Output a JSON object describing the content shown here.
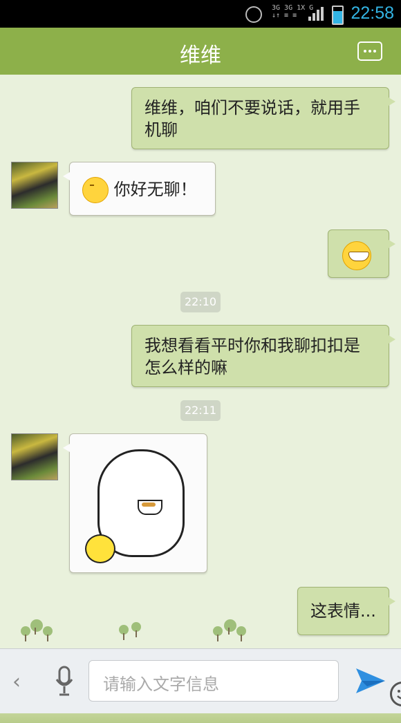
{
  "status": {
    "time": "22:58",
    "net_top": "3G 3G 1X G",
    "net_bottom": "↓↑ ≡ ≡"
  },
  "header": {
    "title": "维维",
    "menu_icon": "more-icon"
  },
  "messages": [
    {
      "dir": "out",
      "text": "维维，咱们不要说话，就用手机聊"
    },
    {
      "dir": "in",
      "text": "你好无聊！",
      "emoji": "sweat-face"
    },
    {
      "dir": "out",
      "emoji": "grin-face"
    },
    {
      "type": "time",
      "text": "22:10"
    },
    {
      "dir": "out",
      "text": "我想看看平时你和我聊扣扣是怎么样的嘛"
    },
    {
      "type": "time",
      "text": "22:11"
    },
    {
      "dir": "in",
      "sticker": "penguin-tea-sticker"
    },
    {
      "dir": "out",
      "text": "这表情..."
    }
  ],
  "input": {
    "placeholder": "请输入文字信息"
  },
  "colors": {
    "title_bar": "#8db04a",
    "out_bubble": "#cfe0ab",
    "status_time": "#33b5e5",
    "send": "#2f8fe0"
  }
}
